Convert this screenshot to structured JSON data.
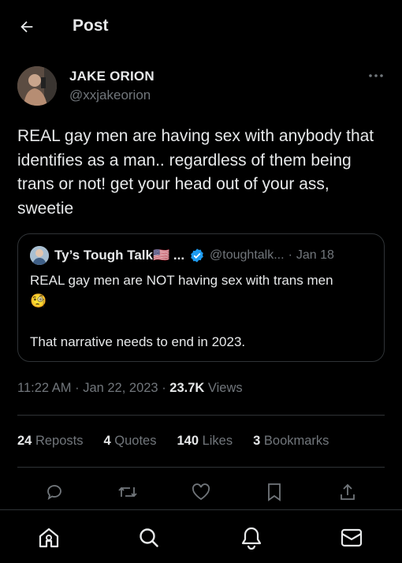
{
  "header": {
    "title": "Post",
    "back_icon": "arrow-left-icon"
  },
  "author": {
    "display_name": "JAKE ORION",
    "handle": "@xxjakeorion",
    "avatar_color": "#6b5a4d"
  },
  "post": {
    "text": "REAL gay men are having sex with anybody that identifies as a man.. regardless of them being trans or not! get your head out of your ass, sweetie"
  },
  "quote": {
    "name": "Ty’s Tough Talk🇺🇸 ...",
    "verified": true,
    "handle": "@toughtalk...",
    "separator": "·",
    "date": "Jan 18",
    "text_line1": "REAL gay men are NOT having sex with trans men",
    "emoji": "🧐",
    "text_line3": "That narrative needs to end in 2023."
  },
  "meta": {
    "time": "11:22 AM",
    "date": "Jan 22, 2023",
    "sep": "·",
    "views_count": "23.7K",
    "views_label": "Views"
  },
  "stats": {
    "reposts_count": "24",
    "reposts_label": "Reposts",
    "quotes_count": "4",
    "quotes_label": "Quotes",
    "likes_count": "140",
    "likes_label": "Likes",
    "bookmarks_count": "3",
    "bookmarks_label": "Bookmarks"
  },
  "actions": [
    "reply-icon",
    "repost-icon",
    "like-icon",
    "bookmark-icon",
    "share-icon"
  ],
  "bottom_nav": [
    "home-icon",
    "search-icon",
    "notifications-icon",
    "messages-icon"
  ],
  "colors": {
    "background": "#000000",
    "text": "#e7e9ea",
    "muted": "#71767b",
    "border": "#2f3336",
    "verified": "#1d9bf0"
  }
}
